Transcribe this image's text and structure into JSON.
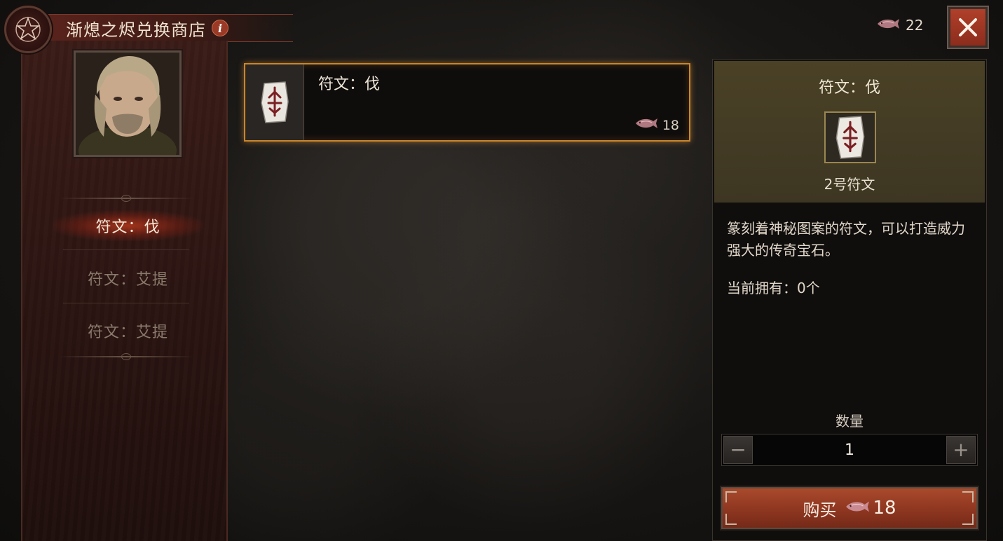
{
  "header": {
    "title": "渐熄之烬兑换商店",
    "info_icon": "i",
    "currency_icon": "ember-fish-icon",
    "currency_amount": "22",
    "close_icon": "close-icon"
  },
  "sidebar": {
    "items": [
      {
        "label": "符文：伐",
        "active": true
      },
      {
        "label": "符文：艾提",
        "active": false
      },
      {
        "label": "符文：艾提",
        "active": false
      }
    ]
  },
  "shop_list": {
    "items": [
      {
        "name": "符文：伐",
        "price": "18",
        "icon": "rune-icon"
      }
    ]
  },
  "detail": {
    "title": "符文：伐",
    "subtitle": "2号符文",
    "description": "篆刻着神秘图案的符文，可以打造威力强大的传奇宝石。",
    "owned": "当前拥有：0个",
    "quantity_label": "数量",
    "quantity_value": "1",
    "minus_symbol": "−",
    "plus_symbol": "+",
    "buy_label": "购买",
    "buy_price": "18"
  },
  "colors": {
    "accent_orange": "#c9862c",
    "button_red": "#8e3620",
    "panel_olive": "#4a4126"
  }
}
